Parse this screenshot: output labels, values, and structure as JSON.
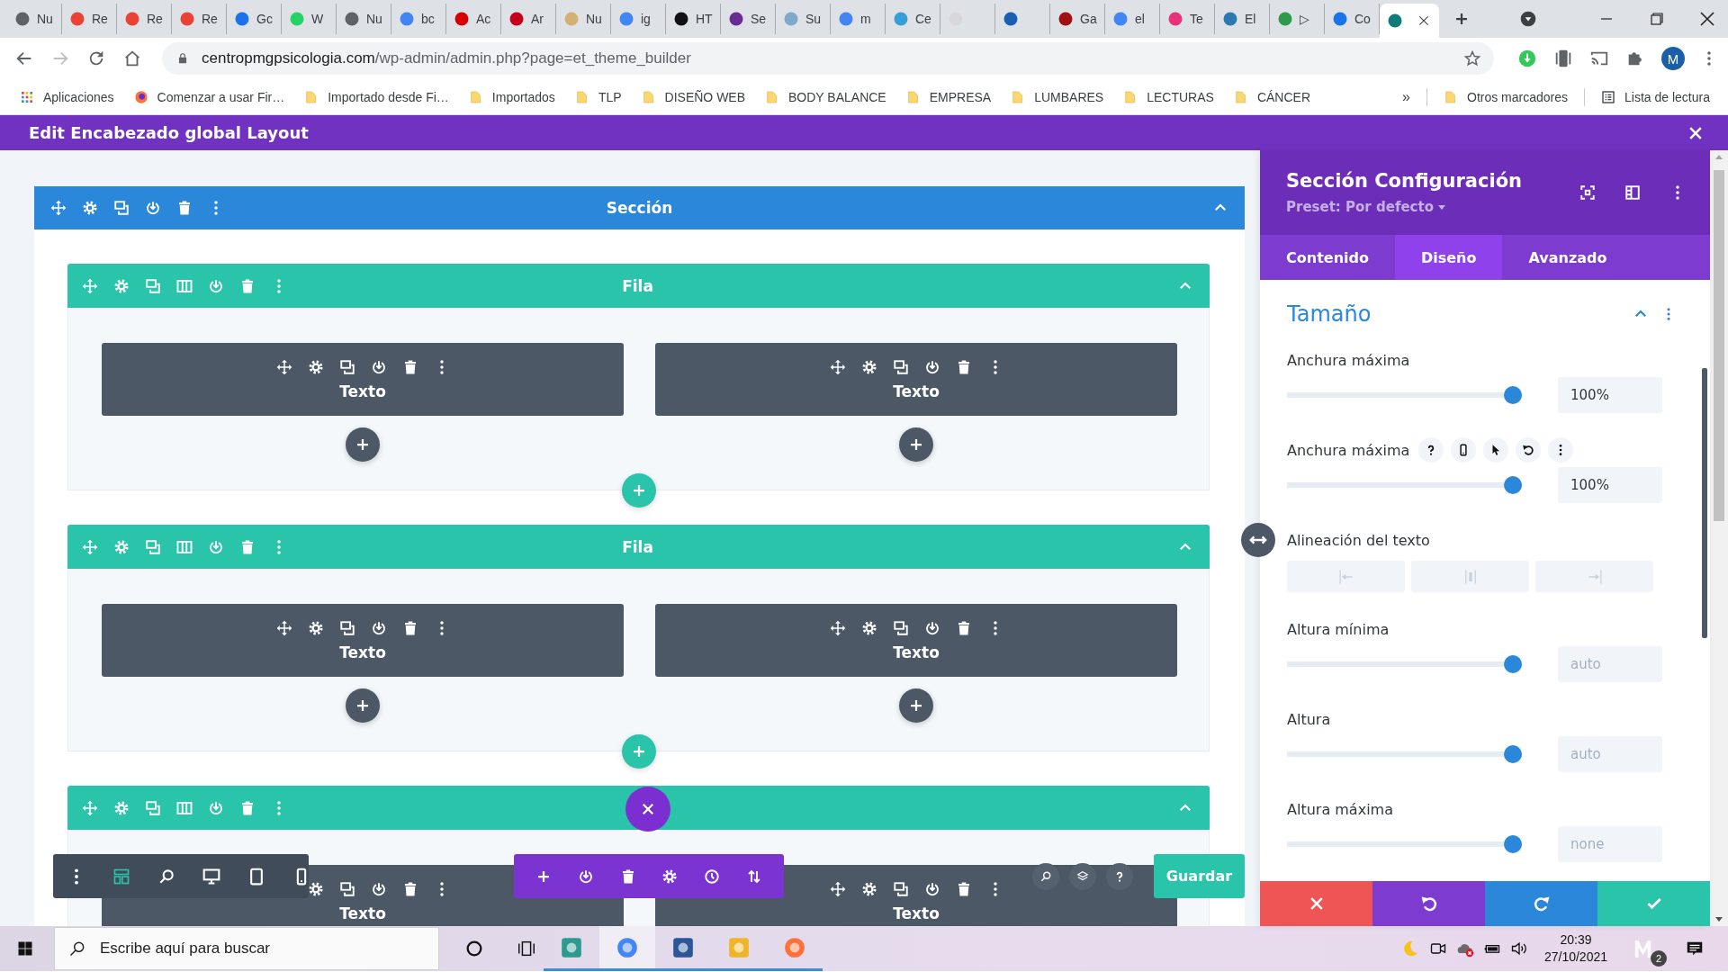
{
  "browser": {
    "tabs": [
      {
        "title": "Nu",
        "selected": false
      },
      {
        "title": "Re",
        "selected": false
      },
      {
        "title": "Re",
        "selected": false
      },
      {
        "title": "Re",
        "selected": false
      },
      {
        "title": "Gc",
        "selected": false
      },
      {
        "title": "W",
        "selected": false
      },
      {
        "title": "Nu",
        "selected": false
      },
      {
        "title": "bc",
        "selected": false
      },
      {
        "title": "Ac",
        "selected": false
      },
      {
        "title": "Ar",
        "selected": false
      },
      {
        "title": "Nu",
        "selected": false
      },
      {
        "title": "ig",
        "selected": false
      },
      {
        "title": "HT",
        "selected": false
      },
      {
        "title": "Se",
        "selected": false
      },
      {
        "title": "Su",
        "selected": false
      },
      {
        "title": "m",
        "selected": false
      },
      {
        "title": "Ce",
        "selected": false
      },
      {
        "selected": false
      },
      {
        "selected": false
      },
      {
        "title": "Ga",
        "selected": false
      },
      {
        "title": "el",
        "selected": false
      },
      {
        "title": "Te",
        "selected": false
      },
      {
        "title": "El",
        "selected": false
      },
      {
        "title": "▷",
        "selected": false
      },
      {
        "title": "Co",
        "selected": false
      },
      {
        "selected": true
      }
    ],
    "forward_disabled": true,
    "address": {
      "host": "centropmgpsicologia.com",
      "path": "/wp-admin/admin.php?page=et_theme_builder"
    },
    "profile": "M",
    "bookmarks": [
      {
        "kind": "apps",
        "label": "Aplicaciones"
      },
      {
        "kind": "firefox",
        "label": "Comenzar a usar Fir…"
      },
      {
        "kind": "folder",
        "label": "Importado desde Fi…"
      },
      {
        "kind": "folder",
        "label": "Importados"
      },
      {
        "kind": "folder",
        "label": "TLP"
      },
      {
        "kind": "folder",
        "label": "DISEÑO WEB"
      },
      {
        "kind": "folder",
        "label": "BODY BALANCE"
      },
      {
        "kind": "folder",
        "label": "EMPRESA"
      },
      {
        "kind": "folder",
        "label": "LUMBARES"
      },
      {
        "kind": "folder",
        "label": "LECTURAS"
      },
      {
        "kind": "folder",
        "label": "CÁNCER"
      }
    ],
    "overflow": "»",
    "other_bookmarks": [
      {
        "kind": "folder",
        "label": "Otros marcadores"
      },
      {
        "kind": "reading",
        "label": "Lista de lectura"
      }
    ]
  },
  "builder": {
    "title": "Edit Encabezado global Layout",
    "section": {
      "label": "Sección",
      "expanded": true,
      "rows": [
        {
          "label": "Fila",
          "expanded": true,
          "add_row_button": true,
          "modules": [
            {
              "label": "Texto",
              "add_button": true
            },
            {
              "label": "Texto",
              "add_button": true
            }
          ]
        },
        {
          "label": "Fila",
          "expanded": true,
          "add_row_button": true,
          "modules": [
            {
              "label": "Texto",
              "add_button": true
            },
            {
              "label": "Texto",
              "add_button": true
            }
          ]
        },
        {
          "expanded": true,
          "modules": [
            {
              "label": "Texto"
            },
            {
              "label": "Texto"
            }
          ]
        }
      ]
    },
    "view_modes": [
      {
        "selected": true
      },
      {
        "selected": false
      },
      {
        "selected": false
      },
      {
        "selected": false
      },
      {
        "selected": false
      }
    ],
    "save": "Guardar"
  },
  "settings": {
    "title": "Sección Configuración",
    "preset": "Preset: Por defecto",
    "tabs": [
      {
        "label": "Contenido",
        "selected": false
      },
      {
        "label": "Diseño",
        "selected": true
      },
      {
        "label": "Avanzado",
        "selected": false
      }
    ],
    "group": {
      "title": "Tamaño",
      "expanded": true
    },
    "fields": [
      {
        "kind": "slider",
        "label": "Anchura máxima",
        "level": 1,
        "value": "100%"
      },
      {
        "kind": "slider",
        "label": "Anchura máxima",
        "level": 1,
        "value": "100%",
        "hovered": true
      },
      {
        "kind": "align",
        "label": "Alineación del texto"
      },
      {
        "kind": "slider",
        "label": "Altura mínima",
        "level": 1,
        "placeholder": "auto"
      },
      {
        "kind": "slider",
        "label": "Altura",
        "level": 1,
        "placeholder": "auto"
      },
      {
        "kind": "slider",
        "label": "Altura máxima",
        "level": 1,
        "placeholder": "none"
      }
    ]
  },
  "taskbar": {
    "search": {
      "placeholder": "Escribe aquí para buscar"
    },
    "apps": [
      {
        "running": true,
        "selected": false
      },
      {
        "running": true,
        "selected": true
      },
      {
        "running": true,
        "selected": false
      },
      {
        "running": true,
        "selected": false
      },
      {
        "running": true,
        "selected": false
      }
    ],
    "time": "20:39",
    "date": "27/10/2021",
    "badge": "2"
  }
}
